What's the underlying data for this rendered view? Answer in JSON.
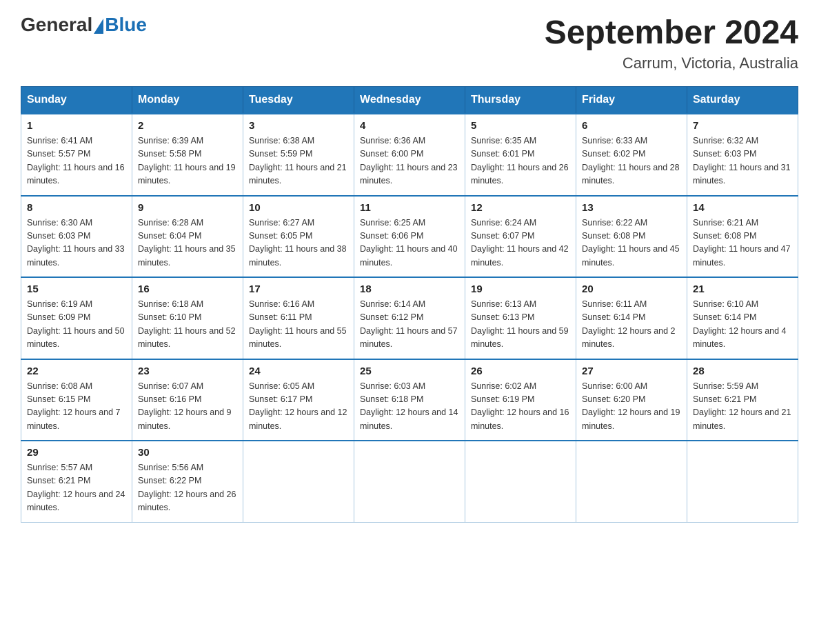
{
  "header": {
    "logo_general": "General",
    "logo_blue": "Blue",
    "month_year": "September 2024",
    "location": "Carrum, Victoria, Australia"
  },
  "weekdays": [
    "Sunday",
    "Monday",
    "Tuesday",
    "Wednesday",
    "Thursday",
    "Friday",
    "Saturday"
  ],
  "weeks": [
    [
      {
        "day": "1",
        "sunrise": "6:41 AM",
        "sunset": "5:57 PM",
        "daylight": "11 hours and 16 minutes."
      },
      {
        "day": "2",
        "sunrise": "6:39 AM",
        "sunset": "5:58 PM",
        "daylight": "11 hours and 19 minutes."
      },
      {
        "day": "3",
        "sunrise": "6:38 AM",
        "sunset": "5:59 PM",
        "daylight": "11 hours and 21 minutes."
      },
      {
        "day": "4",
        "sunrise": "6:36 AM",
        "sunset": "6:00 PM",
        "daylight": "11 hours and 23 minutes."
      },
      {
        "day": "5",
        "sunrise": "6:35 AM",
        "sunset": "6:01 PM",
        "daylight": "11 hours and 26 minutes."
      },
      {
        "day": "6",
        "sunrise": "6:33 AM",
        "sunset": "6:02 PM",
        "daylight": "11 hours and 28 minutes."
      },
      {
        "day": "7",
        "sunrise": "6:32 AM",
        "sunset": "6:03 PM",
        "daylight": "11 hours and 31 minutes."
      }
    ],
    [
      {
        "day": "8",
        "sunrise": "6:30 AM",
        "sunset": "6:03 PM",
        "daylight": "11 hours and 33 minutes."
      },
      {
        "day": "9",
        "sunrise": "6:28 AM",
        "sunset": "6:04 PM",
        "daylight": "11 hours and 35 minutes."
      },
      {
        "day": "10",
        "sunrise": "6:27 AM",
        "sunset": "6:05 PM",
        "daylight": "11 hours and 38 minutes."
      },
      {
        "day": "11",
        "sunrise": "6:25 AM",
        "sunset": "6:06 PM",
        "daylight": "11 hours and 40 minutes."
      },
      {
        "day": "12",
        "sunrise": "6:24 AM",
        "sunset": "6:07 PM",
        "daylight": "11 hours and 42 minutes."
      },
      {
        "day": "13",
        "sunrise": "6:22 AM",
        "sunset": "6:08 PM",
        "daylight": "11 hours and 45 minutes."
      },
      {
        "day": "14",
        "sunrise": "6:21 AM",
        "sunset": "6:08 PM",
        "daylight": "11 hours and 47 minutes."
      }
    ],
    [
      {
        "day": "15",
        "sunrise": "6:19 AM",
        "sunset": "6:09 PM",
        "daylight": "11 hours and 50 minutes."
      },
      {
        "day": "16",
        "sunrise": "6:18 AM",
        "sunset": "6:10 PM",
        "daylight": "11 hours and 52 minutes."
      },
      {
        "day": "17",
        "sunrise": "6:16 AM",
        "sunset": "6:11 PM",
        "daylight": "11 hours and 55 minutes."
      },
      {
        "day": "18",
        "sunrise": "6:14 AM",
        "sunset": "6:12 PM",
        "daylight": "11 hours and 57 minutes."
      },
      {
        "day": "19",
        "sunrise": "6:13 AM",
        "sunset": "6:13 PM",
        "daylight": "11 hours and 59 minutes."
      },
      {
        "day": "20",
        "sunrise": "6:11 AM",
        "sunset": "6:14 PM",
        "daylight": "12 hours and 2 minutes."
      },
      {
        "day": "21",
        "sunrise": "6:10 AM",
        "sunset": "6:14 PM",
        "daylight": "12 hours and 4 minutes."
      }
    ],
    [
      {
        "day": "22",
        "sunrise": "6:08 AM",
        "sunset": "6:15 PM",
        "daylight": "12 hours and 7 minutes."
      },
      {
        "day": "23",
        "sunrise": "6:07 AM",
        "sunset": "6:16 PM",
        "daylight": "12 hours and 9 minutes."
      },
      {
        "day": "24",
        "sunrise": "6:05 AM",
        "sunset": "6:17 PM",
        "daylight": "12 hours and 12 minutes."
      },
      {
        "day": "25",
        "sunrise": "6:03 AM",
        "sunset": "6:18 PM",
        "daylight": "12 hours and 14 minutes."
      },
      {
        "day": "26",
        "sunrise": "6:02 AM",
        "sunset": "6:19 PM",
        "daylight": "12 hours and 16 minutes."
      },
      {
        "day": "27",
        "sunrise": "6:00 AM",
        "sunset": "6:20 PM",
        "daylight": "12 hours and 19 minutes."
      },
      {
        "day": "28",
        "sunrise": "5:59 AM",
        "sunset": "6:21 PM",
        "daylight": "12 hours and 21 minutes."
      }
    ],
    [
      {
        "day": "29",
        "sunrise": "5:57 AM",
        "sunset": "6:21 PM",
        "daylight": "12 hours and 24 minutes."
      },
      {
        "day": "30",
        "sunrise": "5:56 AM",
        "sunset": "6:22 PM",
        "daylight": "12 hours and 26 minutes."
      },
      null,
      null,
      null,
      null,
      null
    ]
  ],
  "labels": {
    "sunrise": "Sunrise:",
    "sunset": "Sunset:",
    "daylight": "Daylight:"
  }
}
